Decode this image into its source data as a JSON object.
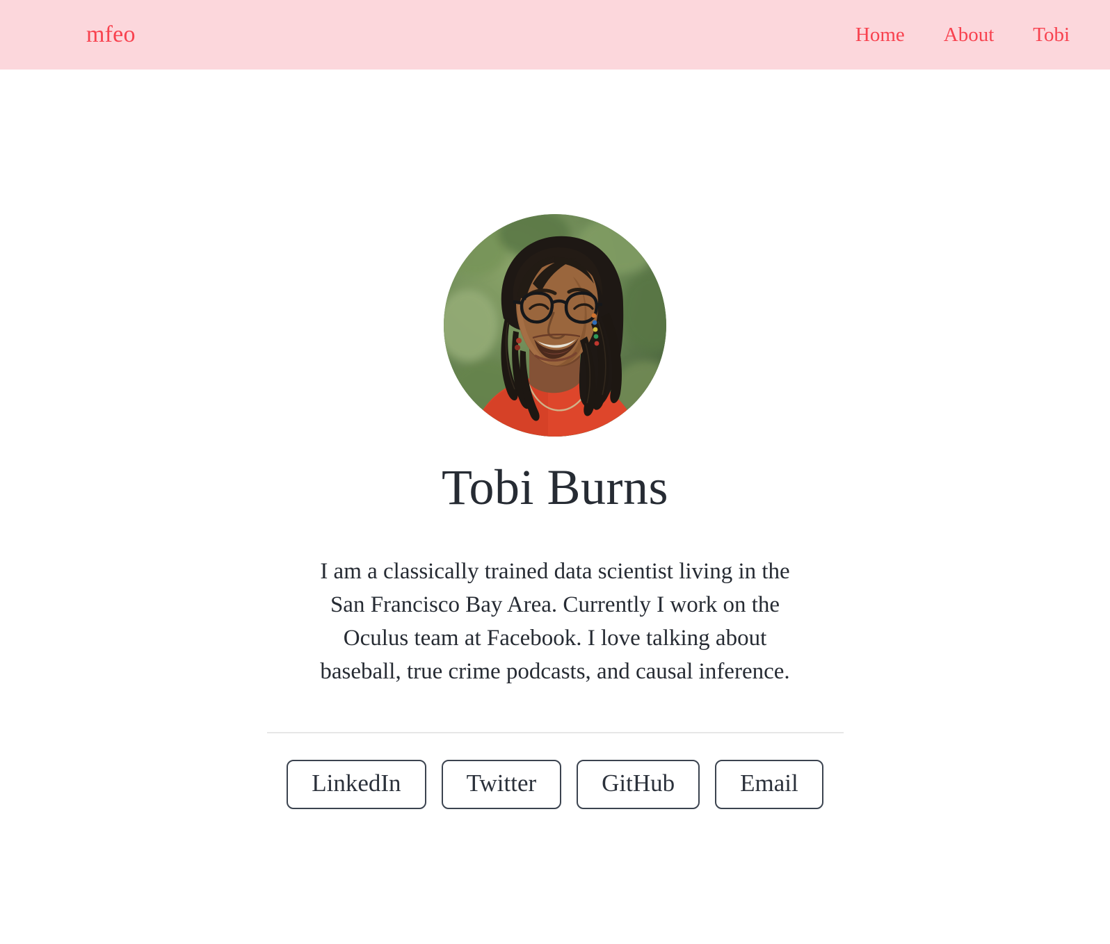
{
  "header": {
    "brand": "mfeo",
    "nav": [
      {
        "label": "Home"
      },
      {
        "label": "About"
      },
      {
        "label": "Tobi"
      }
    ]
  },
  "profile": {
    "avatar_alt": "Portrait of a smiling woman with locs, black round glasses, a beaded earring and an orange-red top, photographed outdoors against blurred green foliage",
    "name": "Tobi Burns",
    "bio": "I am a classically trained data scientist living in the San Francisco Bay Area. Currently I work on the Oculus team at Facebook. I love talking about baseball, true crime podcasts, and causal inference."
  },
  "links": [
    {
      "label": "LinkedIn"
    },
    {
      "label": "Twitter"
    },
    {
      "label": "GitHub"
    },
    {
      "label": "Email"
    }
  ],
  "colors": {
    "header_background": "#fcd7dc",
    "accent": "#f8424f",
    "text": "#262b33",
    "divider": "#e6e6e6",
    "button_border": "#3b434f",
    "page_background": "#ffffff"
  }
}
